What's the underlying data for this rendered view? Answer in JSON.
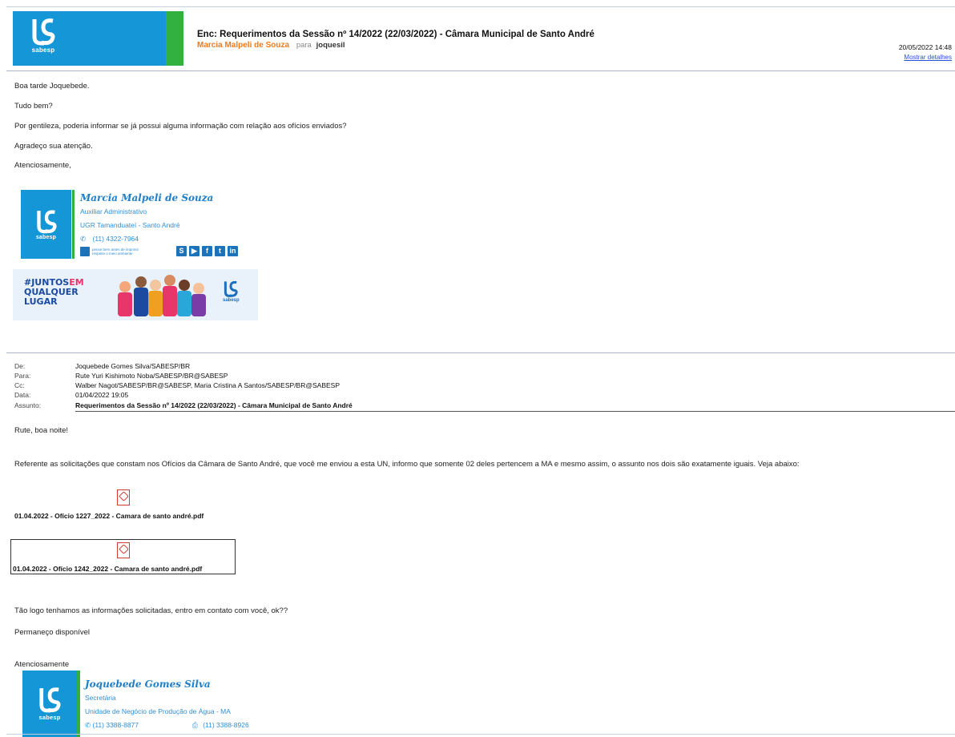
{
  "header": {
    "logo_text": "sabesp",
    "subject": "Enc: Requerimentos da Sessão nº 14/2022 (22/03/2022) - Câmara Municipal de Santo André",
    "sender": "Marcia Malpeli de Souza",
    "to_label": "para",
    "to_value": "joquesil",
    "date": "20/05/2022 14:48",
    "details_link": "Mostrar detalhes"
  },
  "message1": {
    "lines": [
      "Boa tarde Joquebede.",
      "Tudo bem?",
      "Por gentileza, poderia informar se já possui alguma informação com relação aos ofícios enviados?",
      "Agradeço sua atenção.",
      "Atenciosamente,"
    ],
    "signature": {
      "logo_text": "sabesp",
      "name": "Marcia Malpeli de Souza",
      "role": "Auxiliar Administrativo",
      "unit": "UGR Tamanduateí - Santo André",
      "phone": "(11) 4322-7964",
      "tagline": "pense bem antes de imprimir respeite o meio ambiente",
      "social_icons": [
        "sabesp-icon",
        "youtube-icon",
        "facebook-icon",
        "twitter-icon",
        "linkedin-icon"
      ]
    },
    "banner": {
      "line1_a": "#JUNTOS",
      "line1_b": "EM",
      "line2": "QUALQUER",
      "line3": "LUGAR",
      "logo_text": "sabesp"
    }
  },
  "forwarded": {
    "fields": [
      {
        "label": "De:",
        "value": "Joquebede Gomes Silva/SABESP/BR"
      },
      {
        "label": "Para:",
        "value": "Rute Yuri Kishimoto Noba/SABESP/BR@SABESP"
      },
      {
        "label": "Cc:",
        "value": "Walber Nagot/SABESP/BR@SABESP, Maria Cristina A Santos/SABESP/BR@SABESP"
      },
      {
        "label": "Data:",
        "value": "01/04/2022 19:05"
      },
      {
        "label": "Assunto:",
        "value": "Requerimentos da Sessão nº 14/2022 (22/03/2022) - Câmara Municipal de Santo André"
      }
    ],
    "greeting": "Rute, boa noite!",
    "paragraph": "Referente  as solicitações que constam nos Ofícios da Câmara de Santo André, que você me enviou a esta UN, informo que somente 02 deles  pertencem a MA e mesmo assim, o assunto nos dois são exatamente iguais. Veja abaixo:",
    "attachments": [
      "01.04.2022 - Ofício 1227_2022 -  Camara de santo andré.pdf",
      "01.04.2022 - Ofício 1242_2022 -  Camara de santo andré.pdf"
    ],
    "closing1": "Tão logo tenhamos as informações solicitadas,  entro em contato com você, ok??",
    "closing2": "Permaneço disponível",
    "closing3": "Atenciosamente",
    "signature": {
      "logo_text": "sabesp",
      "name": "Joquebede Gomes Silva",
      "role": "Secretária",
      "unit": "Unidade de Negócio de Produção de Água - MA",
      "phone": "(11) 3388-8877",
      "fax": "(11) 3388-8926"
    }
  },
  "colors": {
    "brand_blue": "#1596d6",
    "brand_green": "#33b140",
    "sender_orange": "#f07a1a",
    "link_blue": "#2a4fd8"
  }
}
